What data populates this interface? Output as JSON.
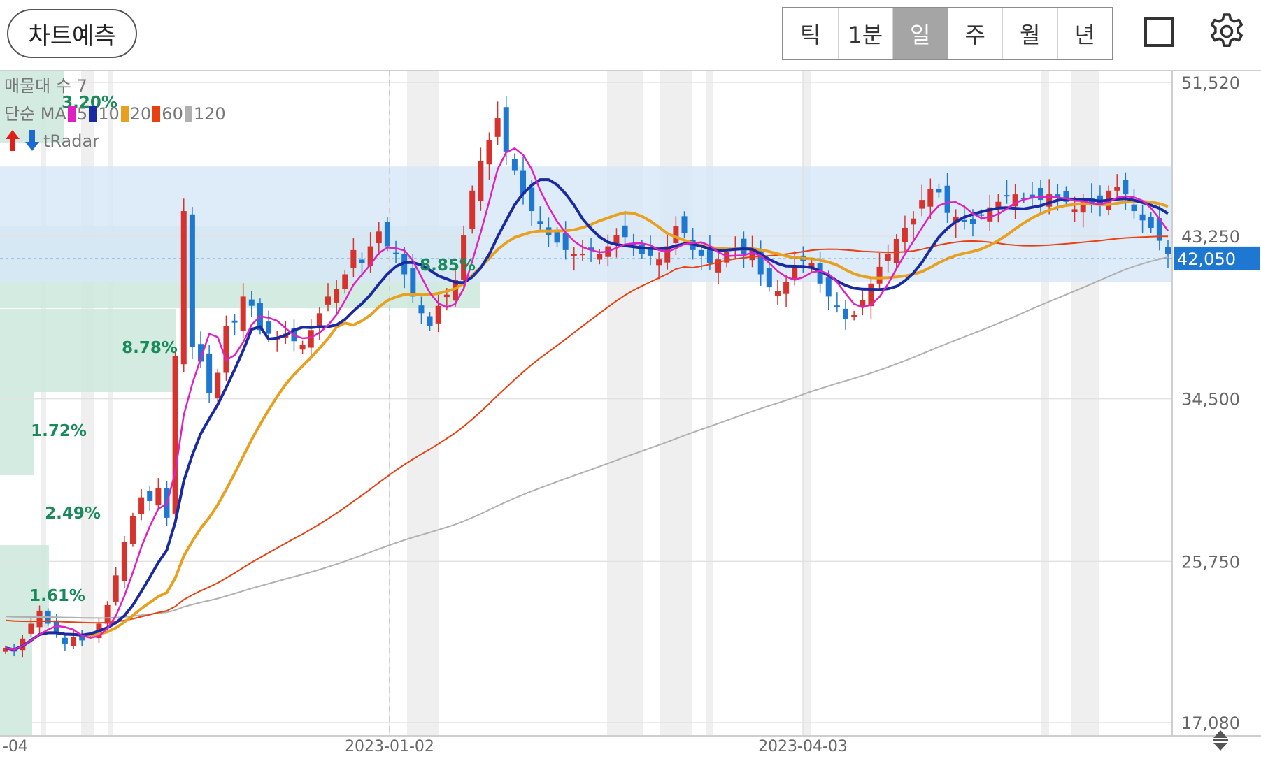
{
  "toolbar": {
    "predict_label": "차트예측",
    "tabs": [
      {
        "label": "틱",
        "active": false
      },
      {
        "label": "1분",
        "active": false
      },
      {
        "label": "일",
        "active": true
      },
      {
        "label": "주",
        "active": false
      },
      {
        "label": "월",
        "active": false
      },
      {
        "label": "년",
        "active": false
      }
    ],
    "icons": {
      "square": "square-icon",
      "settings": "gear-icon"
    }
  },
  "legend": {
    "volume_profile": "매물대 수 7",
    "ma_label": "단순 MA",
    "ma_periods": [
      {
        "period": "5",
        "color": "#e020c0"
      },
      {
        "period": "10",
        "color": "#1a2aa0"
      },
      {
        "period": "20",
        "color": "#e8a020"
      },
      {
        "period": "60",
        "color": "#e84010"
      },
      {
        "period": "120",
        "color": "#b0b0b0"
      }
    ],
    "radar_label": "tRadar"
  },
  "chart_data": {
    "type": "candlestick",
    "y_ticks": [
      "51,520",
      "43,250",
      "34,500",
      "25,750",
      "17,080"
    ],
    "y_tick_values": [
      51520,
      43250,
      34500,
      25750,
      17080
    ],
    "ylim": [
      17080,
      51520
    ],
    "x_labels": [
      "-04",
      "2023-01-02",
      "2023-04-03"
    ],
    "current_price": "42,050",
    "colors": {
      "up": "#d6332e",
      "down": "#1e78d2",
      "ma5": "#e020c0",
      "ma10": "#1a2aa0",
      "ma20": "#e8a020",
      "ma60": "#e84010",
      "ma120": "#b0b0b0",
      "price_tag": "#1e78d2",
      "volume_profile": "#cde8dc",
      "highlight_band": "#d6e7f7"
    },
    "volume_profile": [
      {
        "label": "3.20%"
      },
      {
        "label": "8.85%"
      },
      {
        "label": "8.78%"
      },
      {
        "label": "1.72%"
      },
      {
        "label": "2.49%"
      },
      {
        "label": "1.61%"
      }
    ],
    "signal_marks": [
      "3",
      "3",
      "3",
      "2",
      "2",
      "2",
      "2",
      "2",
      "0",
      "3",
      "3",
      "2",
      "3",
      "0",
      "0",
      "2",
      "1",
      "1",
      "0",
      "1",
      "3",
      "3",
      "2",
      "0",
      "2",
      "3",
      "2",
      "2",
      "1",
      "0",
      "1",
      "3",
      "0"
    ],
    "series_approx": {
      "close": [
        21100,
        20900,
        21600,
        22400,
        23100,
        22400,
        21900,
        21300,
        21700,
        21500,
        21800,
        22400,
        23400,
        25000,
        26800,
        28200,
        29200,
        29000,
        29700,
        28100,
        36800,
        44600,
        37300,
        36500,
        34800,
        35900,
        38400,
        38600,
        40000,
        39500,
        38200,
        38000,
        37800,
        38000,
        37600,
        37400,
        38200,
        39100,
        40000,
        40400,
        41200,
        42500,
        41800,
        42700,
        43500,
        42700,
        42300,
        41200,
        40000,
        39100,
        38400,
        39500,
        40100,
        40900,
        43300,
        45700,
        47300,
        48400,
        49600,
        47800,
        46800,
        45500,
        44600,
        43900,
        43300,
        42900,
        42500,
        42300,
        42300,
        42500,
        42300,
        42700,
        43300,
        43200,
        42800,
        42300,
        42200,
        42000,
        42700,
        43800,
        43400,
        42500,
        42200,
        41800,
        42000,
        42400,
        42600,
        42300,
        42500,
        41200,
        40500,
        40300,
        40800,
        41700,
        41900,
        41800,
        40700,
        40000,
        39500,
        38800,
        39000,
        39800,
        40700,
        41600,
        42300,
        43100,
        43700,
        44200,
        45200,
        45800,
        45600,
        44500,
        44300,
        44000,
        43900,
        44400,
        44800,
        45100,
        45400,
        45500,
        45300,
        45300,
        45200,
        45500,
        45300,
        45100,
        44700,
        45100,
        44900,
        45000,
        45700,
        45900,
        45500,
        44600,
        44100,
        43700,
        43000,
        42300
      ]
    }
  }
}
